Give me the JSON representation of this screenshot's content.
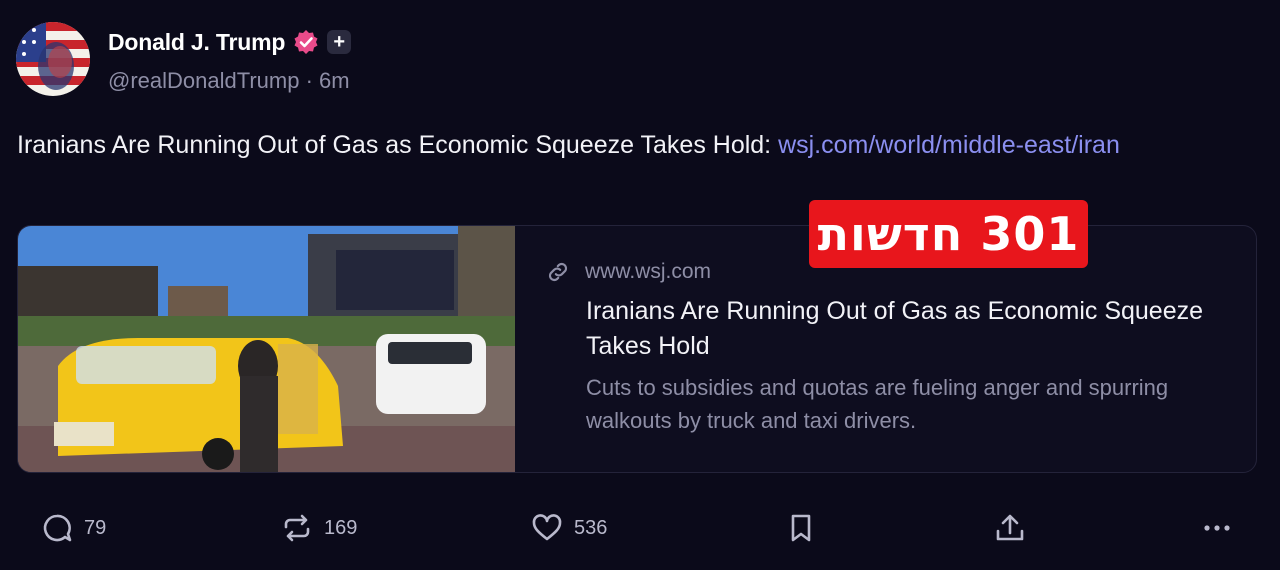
{
  "author": {
    "display_name": "Donald J. Trump",
    "handle": "@realDonaldTrump",
    "separator": " · ",
    "time_ago": "6m",
    "verified_color": "#e84b8a"
  },
  "post": {
    "text": "Iranians Are Running Out of Gas as Economic Squeeze Takes Hold: ",
    "link": "wsj.com/world/middle-east/iran"
  },
  "card": {
    "domain": "www.wsj.com",
    "title": "Iranians Are Running Out of Gas as Economic Squeeze Takes Hold",
    "description": "Cuts to subsidies and quotas are fueling anger and spurring walkouts by truck and taxi drivers.",
    "image_billboard_text": "",
    "taxi_plate_text": ""
  },
  "overlay": {
    "text": "301 חדשות",
    "color": "#e8161c"
  },
  "actions": {
    "replies": "79",
    "reposts": "169",
    "likes": "536"
  },
  "colors": {
    "background": "#0b0a1a",
    "link": "#8b8ff0",
    "muted": "#8e8ea6"
  }
}
